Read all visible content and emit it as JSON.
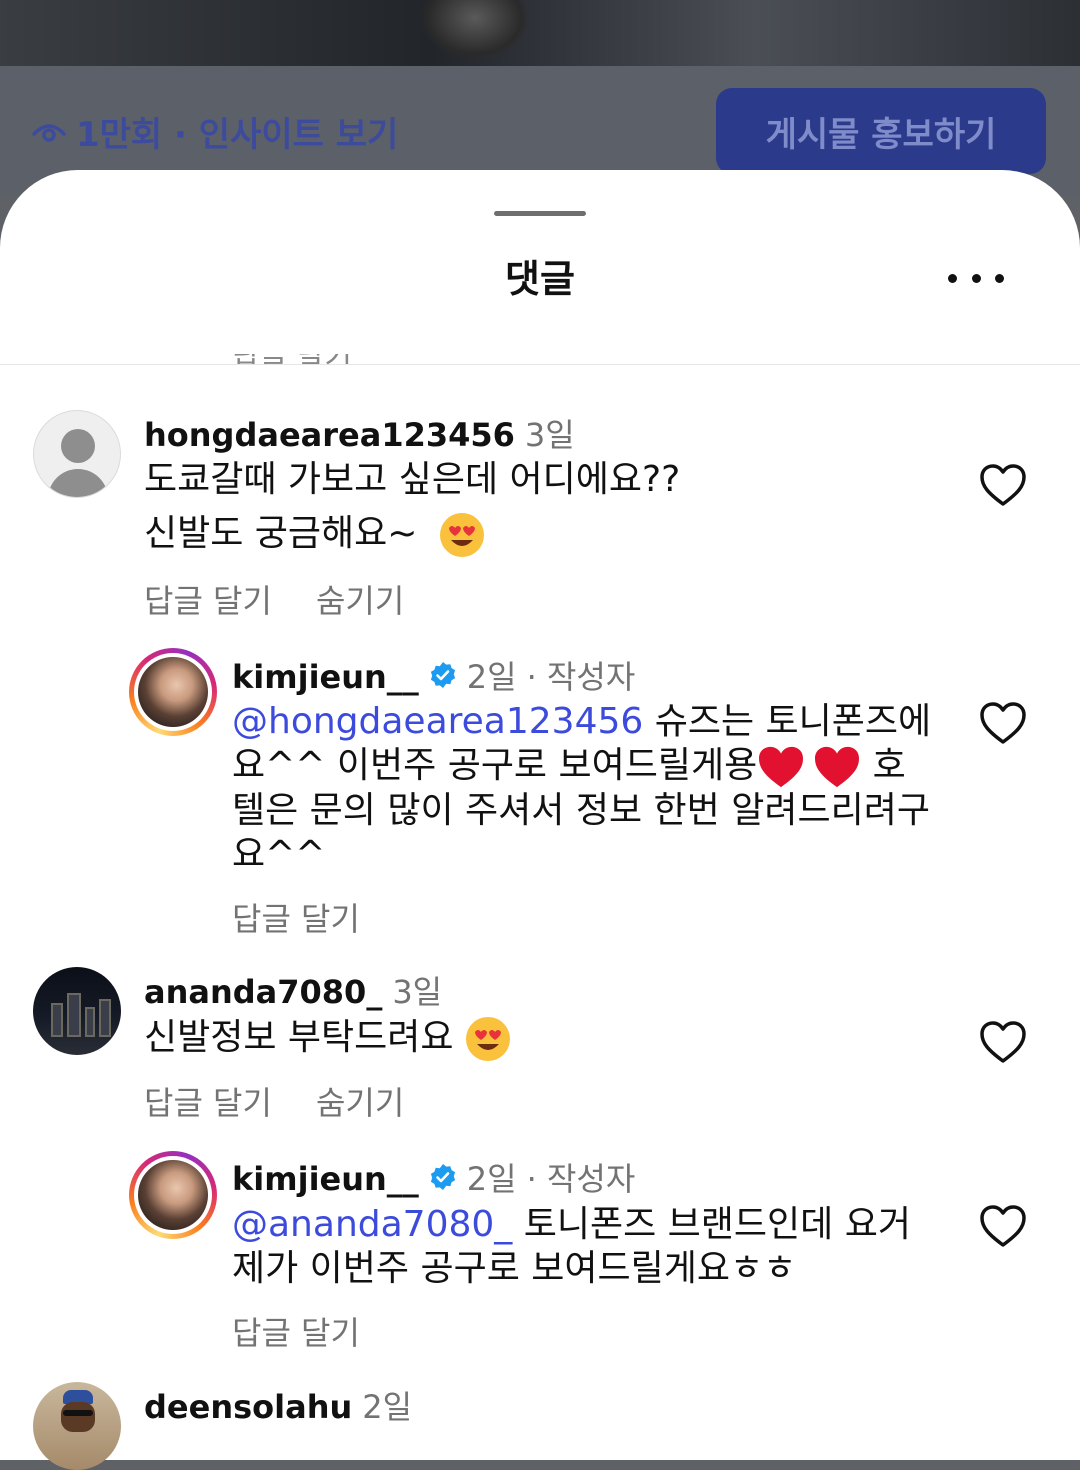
{
  "background": {
    "insight_text": "1만회 · 인사이트 보기",
    "promote_button": "게시물 홍보하기"
  },
  "sheet": {
    "title": "댓글",
    "cut_off_text": "답글 달기"
  },
  "comments": [
    {
      "username": "hongdaearea123456",
      "time": "3일",
      "text_line1": "도쿄갈때 가보고 싶은데 어디에요??",
      "text_line2": "신발도 궁금해요~",
      "reply_label": "답글 달기",
      "hide_label": "숨기기",
      "reply": {
        "username": "kimjieun__",
        "time": "2일",
        "author_tag": "· 작성자",
        "mention": "@hongdaearea123456",
        "line1_rest": " 슈즈는 토니폰즈에",
        "line2": "요^^ 이번주 공구로 보여드릴게용",
        "line2_end": " 호",
        "line3": "텔은 문의 많이 주셔서 정보 한번 알려드리려구",
        "line4": "요^^",
        "reply_label": "답글 달기"
      }
    },
    {
      "username": "ananda7080_",
      "time": "3일",
      "text_line1": "신발정보 부탁드려요",
      "reply_label": "답글 달기",
      "hide_label": "숨기기",
      "reply": {
        "username": "kimjieun__",
        "time": "2일",
        "author_tag": "· 작성자",
        "mention": "@ananda7080_",
        "line1_rest": " 토니폰즈 브랜드인데 요거",
        "line2": "제가 이번주 공구로 보여드릴게요ㅎㅎ",
        "reply_label": "답글 달기"
      }
    },
    {
      "username": "deensolahu",
      "time": "2일"
    }
  ],
  "icons": {
    "eye": "eye-icon",
    "more": "more-icon",
    "heart": "heart-outline-icon",
    "verified": "verified-badge-icon",
    "emoji_heart_eyes": "heart-eyes-emoji",
    "emoji_red_heart": "red-heart-emoji"
  },
  "colors": {
    "accent_link": "#3c4bdc",
    "secondary_text": "#737373",
    "verified_blue": "#1d9bf0",
    "promote_button_bg": "#2c3a8c"
  }
}
